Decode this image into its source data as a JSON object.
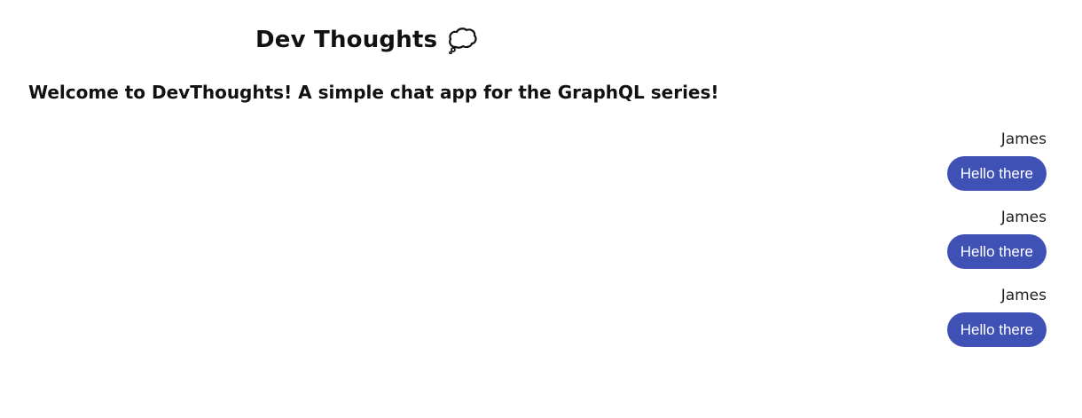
{
  "header": {
    "title": "Dev Thoughts",
    "icon": "thought-balloon-icon"
  },
  "welcome_text": "Welcome to DevThoughts! A simple chat app for the GraphQL series!",
  "colors": {
    "bubble_background": "#3f51b5",
    "bubble_text": "#ffffff"
  },
  "messages": [
    {
      "sender": "James",
      "text": "Hello there"
    },
    {
      "sender": "James",
      "text": "Hello there"
    },
    {
      "sender": "James",
      "text": "Hello there"
    }
  ]
}
